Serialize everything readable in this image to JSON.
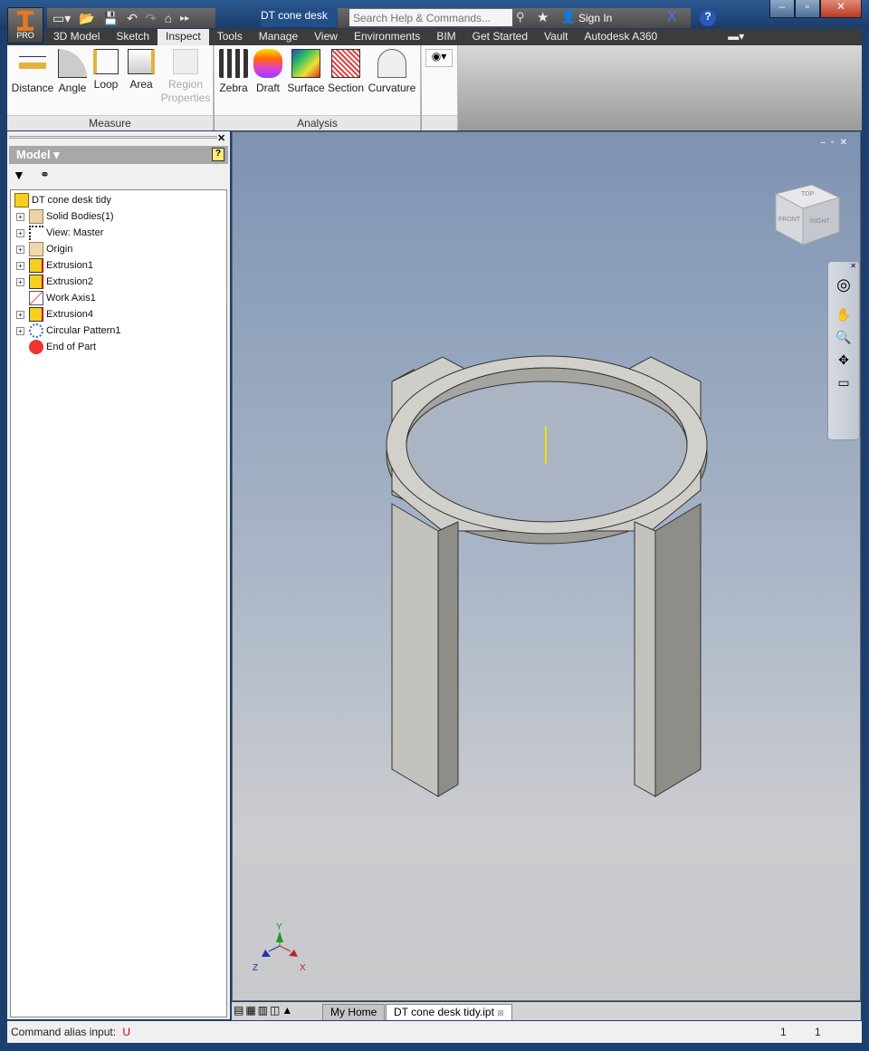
{
  "app": {
    "edition": "PRO",
    "document_title": "DT cone desk ...",
    "search_placeholder": "Search Help & Commands...",
    "sign_in": "Sign In"
  },
  "ribbon_tabs": [
    "3D Model",
    "Sketch",
    "Inspect",
    "Tools",
    "Manage",
    "View",
    "Environments",
    "BIM",
    "Get Started",
    "Vault",
    "Autodesk A360"
  ],
  "active_tab": "Inspect",
  "measure": {
    "caption": "Measure",
    "tools": [
      "Distance",
      "Angle",
      "Loop",
      "Area"
    ],
    "region": [
      "Region",
      "Properties"
    ]
  },
  "analysis": {
    "caption": "Analysis",
    "tools": [
      "Zebra",
      "Draft",
      "Surface",
      "Section",
      "Curvature"
    ]
  },
  "browser": {
    "title": "Model ▾",
    "items": [
      {
        "label": "DT cone desk tidy",
        "icon": "part-icon",
        "expand": false
      },
      {
        "label": "Solid Bodies(1)",
        "icon": "solid-bodies-folder-icon",
        "expand": true
      },
      {
        "label": "View: Master",
        "icon": "view-rep-icon",
        "expand": true
      },
      {
        "label": "Origin",
        "icon": "folder-icon",
        "expand": true
      },
      {
        "label": "Extrusion1",
        "icon": "extrusion-icon",
        "expand": true
      },
      {
        "label": "Extrusion2",
        "icon": "extrusion-icon",
        "expand": true
      },
      {
        "label": "Work Axis1",
        "icon": "work-axis-icon",
        "expand": false
      },
      {
        "label": "Extrusion4",
        "icon": "extrusion-icon",
        "expand": true
      },
      {
        "label": "Circular Pattern1",
        "icon": "circular-pattern-icon",
        "expand": true
      },
      {
        "label": "End of Part",
        "icon": "end-of-part-icon",
        "expand": false
      }
    ]
  },
  "viewcube": {
    "top": "TOP",
    "front": "FRONT",
    "right": "RIGHT"
  },
  "triad": {
    "x": "X",
    "y": "Y",
    "z": "Z",
    "colors": {
      "x": "#c0262c",
      "y": "#1a9a2a",
      "z": "#2030b0"
    }
  },
  "doc_tabs": {
    "home": "My Home",
    "active": "DT cone desk tidy.ipt"
  },
  "status": {
    "label": "Command alias input:",
    "value": "U",
    "count1": "1",
    "count2": "1"
  }
}
